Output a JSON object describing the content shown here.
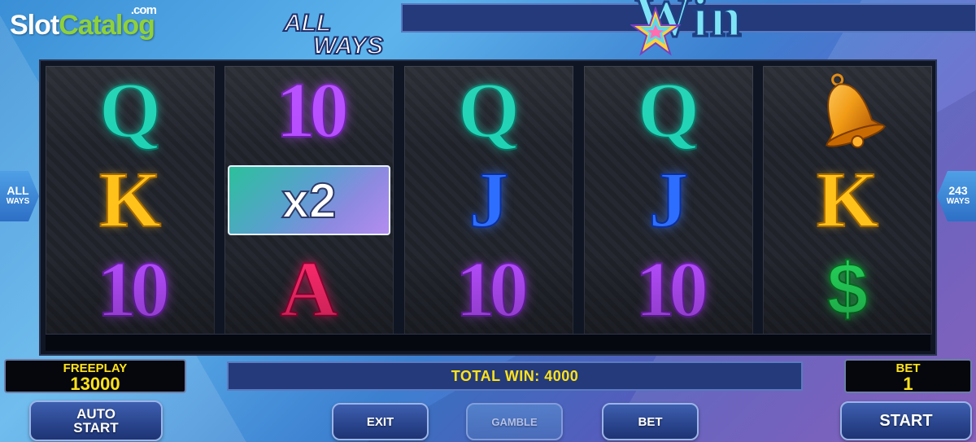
{
  "watermark": {
    "slot": "Slot",
    "catalog": "Catalog",
    "com": ".com"
  },
  "logo": {
    "line1": "ALL",
    "line2": "WAYS",
    "line3": "Win"
  },
  "side_badges": {
    "left": {
      "line1": "ALL",
      "line2": "WAYS"
    },
    "right": {
      "line1": "243",
      "line2": "WAYS"
    }
  },
  "reels": [
    {
      "symbols": [
        "Q",
        "K",
        "10"
      ]
    },
    {
      "symbols": [
        "10",
        "x2",
        "A"
      ]
    },
    {
      "symbols": [
        "Q",
        "J",
        "10"
      ]
    },
    {
      "symbols": [
        "Q",
        "J",
        "10"
      ]
    },
    {
      "symbols": [
        "bell-icon",
        "K",
        "$"
      ]
    }
  ],
  "multiplier": {
    "label": "x2"
  },
  "freeplay": {
    "label": "FREEPLAY",
    "value": "13000"
  },
  "total_win": {
    "text": "TOTAL WIN: 4000"
  },
  "bet": {
    "label": "BET",
    "value": "1"
  },
  "buttons": {
    "auto_line1": "AUTO",
    "auto_line2": "START",
    "exit": "EXIT",
    "gamble": "GAMBLE",
    "bet": "BET",
    "start": "START"
  },
  "colors": {
    "q": "#1fd3b4",
    "ten": "#b64cff",
    "k": "#ffc21a",
    "j": "#2d6eff",
    "a": "#ff2a6d",
    "dollar": "#25d35a",
    "panel_text": "#ffe21a"
  }
}
